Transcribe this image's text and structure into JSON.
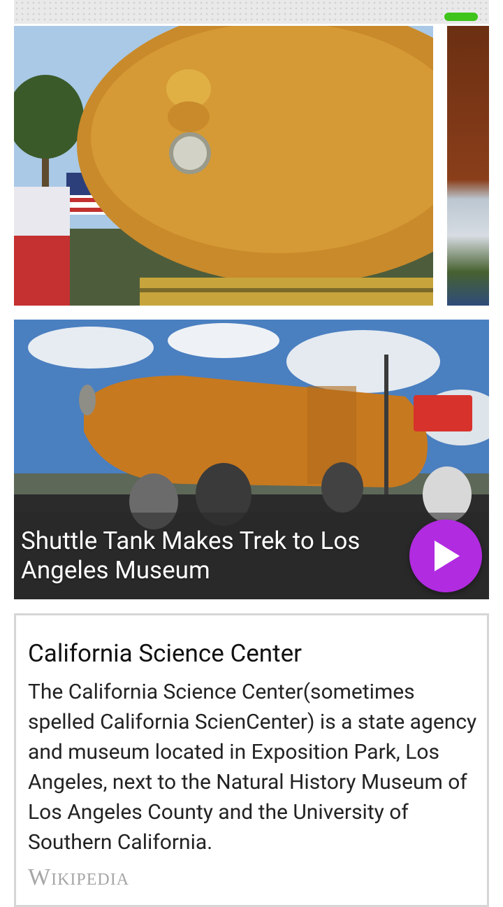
{
  "status_bar": {
    "accent_color": "#3ec41a"
  },
  "carousel": {
    "slides": [
      {
        "image_alt": ""
      },
      {
        "image_alt": ""
      }
    ]
  },
  "video": {
    "title": "Shuttle Tank Makes Trek to Los Angeles Museum",
    "play_icon": "play-icon",
    "play_color": "#b12be0"
  },
  "info": {
    "title": "California Science Center",
    "body": "The California Science Center(sometimes spelled California ScienCenter) is a state agency and museum located in Exposition Park, Los Angeles, next to the Natural History Museum of Los Angeles County and the University of Southern California.",
    "source": "Wikipedia"
  }
}
